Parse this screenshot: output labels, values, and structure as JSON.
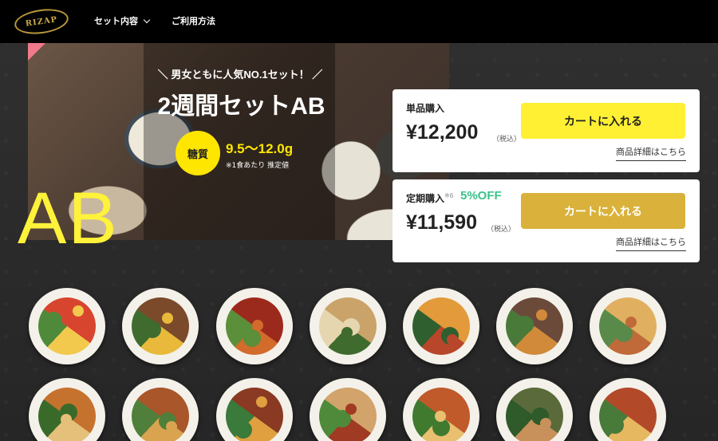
{
  "header": {
    "logo_text": "RIZAP",
    "nav": [
      {
        "label": "セット内容"
      },
      {
        "label": "ご利用方法"
      }
    ]
  },
  "hero": {
    "tagline": "＼ 男女ともに人気NO.1セット！ ／",
    "title": "2週間セットAB",
    "carb_label": "糖質",
    "carb_value": "9.5～12.0g",
    "carb_note": "※1食あたり 推定値",
    "overlay_text": "AB"
  },
  "single": {
    "label": "単品購入",
    "price": "¥12,200",
    "tax": "（税込）",
    "button": "カートに入れる",
    "link": "商品詳細はこちら"
  },
  "subscription": {
    "label": "定期購入",
    "label_note": "※6",
    "discount": "5%OFF",
    "price": "¥11,590",
    "tax": "（税込）",
    "button": "カートに入れる",
    "link": "商品詳細はこちら"
  },
  "colors": {
    "accent_yellow": "#fff033",
    "gold_button": "#d9b13b",
    "discount_green": "#3cc28a",
    "header_bg": "#000000"
  },
  "dishes": [
    {
      "name": "meal-1"
    },
    {
      "name": "meal-2"
    },
    {
      "name": "meal-3"
    },
    {
      "name": "meal-4"
    },
    {
      "name": "meal-5"
    },
    {
      "name": "meal-6"
    },
    {
      "name": "meal-7"
    },
    {
      "name": "meal-8"
    },
    {
      "name": "meal-9"
    },
    {
      "name": "meal-10"
    },
    {
      "name": "meal-11"
    },
    {
      "name": "meal-12"
    },
    {
      "name": "meal-13"
    },
    {
      "name": "meal-14"
    }
  ]
}
